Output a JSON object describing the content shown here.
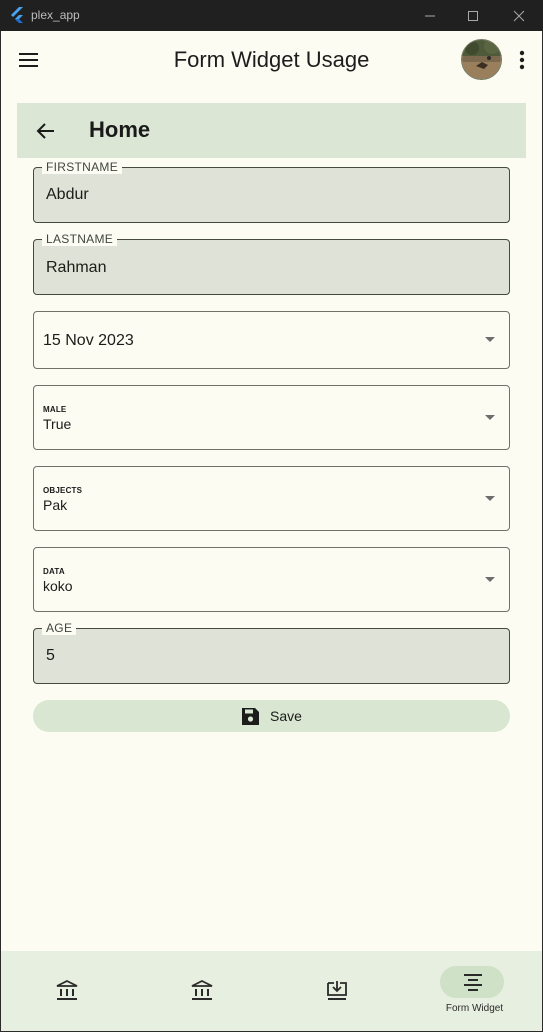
{
  "window": {
    "title": "plex_app"
  },
  "appbar": {
    "title": "Form Widget Usage"
  },
  "subheader": {
    "title": "Home"
  },
  "form": {
    "firstname": {
      "label": "FIRSTNAME",
      "value": "Abdur"
    },
    "lastname": {
      "label": "LASTNAME",
      "value": "Rahman"
    },
    "date": {
      "value": "15 Nov 2023"
    },
    "male": {
      "label": "MALE",
      "value": "True"
    },
    "objects": {
      "label": "OBJECTS",
      "value": "Pak"
    },
    "data": {
      "label": "DATA",
      "value": "koko"
    },
    "age": {
      "label": "AGE",
      "value": "5"
    },
    "save_label": "Save"
  },
  "bottom_nav": {
    "items": [
      {
        "icon": "bank-icon",
        "label": ""
      },
      {
        "icon": "bank-icon",
        "label": ""
      },
      {
        "icon": "download-to-screen-icon",
        "label": ""
      },
      {
        "icon": "align-center-icon",
        "label": "Form Widget",
        "active": true
      }
    ]
  },
  "colors": {
    "background": "#fcfcf3",
    "subheader": "#dbe6d4",
    "filled_field": "#dfe2d6",
    "save_button": "#d9e6d1",
    "navbar": "#e7efe0",
    "nav_active_pill": "#cfe1c6"
  }
}
